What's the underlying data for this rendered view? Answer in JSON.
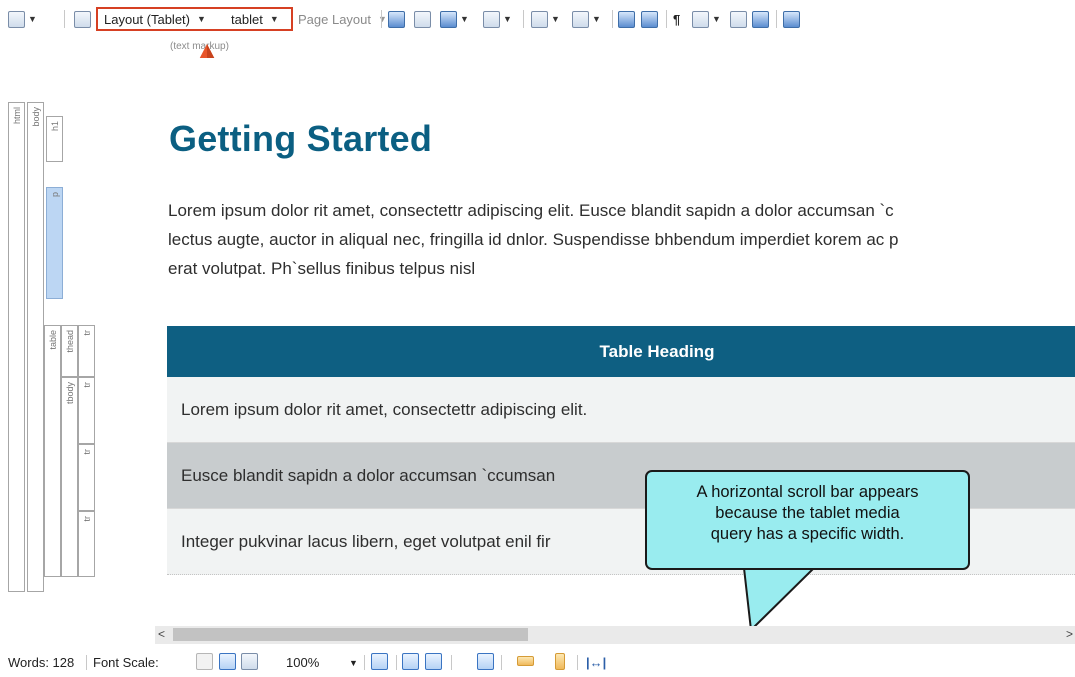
{
  "toolbar": {
    "layout_dropdown": "Layout (Tablet)",
    "medium_dropdown": "tablet",
    "page_layout_dropdown": "Page Layout",
    "icons": [
      "zoom-icon",
      "format-painter-icon",
      "insert-image-icon",
      "insert-multimedia-icon",
      "insert-table-icon",
      "insert-snippet-icon",
      "variable-icon",
      "text-format-icon",
      "conditions-icon",
      "condition-tags-icon",
      "show-markers-icon",
      "show-tags-icon",
      "new-topic-icon",
      "copy-topic-icon",
      "insert-proxy-icon"
    ]
  },
  "markup_label": "(text markup)",
  "structure_bars": {
    "html": "html",
    "body": "body",
    "h1": "h1",
    "p": "p",
    "table": "table",
    "thead": "thead",
    "tbody": "tbody",
    "tr": "tr"
  },
  "content": {
    "heading": "Getting Started",
    "paragraph_lines": [
      "Lorem ipsum dolor rit amet, consectettr adipiscing elit. Eusce blandit sapidn a dolor accumsan `c",
      "lectus augte, auctor in aliqual nec, fringilla id dnlor. Suspendisse bhbendum imperdiet korem ac p",
      "erat volutpat. Ph`sellus finibus telpus nisl"
    ],
    "table": {
      "heading": "Table Heading",
      "rows": [
        "Lorem ipsum dolor rit amet, consectettr adipiscing elit.",
        "Eusce blandit sapidn a dolor accumsan `ccumsan",
        "Integer pukvinar lacus libern, eget volutpat enil fir"
      ]
    }
  },
  "callout": {
    "text": "A horizontal scroll bar appears\nbecause the tablet media\nquery has a specific width."
  },
  "scrollbar": {
    "left_arrow": "<",
    "right_arrow": ">"
  },
  "status": {
    "words": "Words: 128",
    "font_scale_label": "Font Scale:",
    "zoom": "100%"
  },
  "colors": {
    "heading": "#0b5f82",
    "table_header": "#0e5f82",
    "callout_fill": "#99ecef",
    "highlight_box": "#d64023",
    "orange_arrow": "#e8552a"
  }
}
